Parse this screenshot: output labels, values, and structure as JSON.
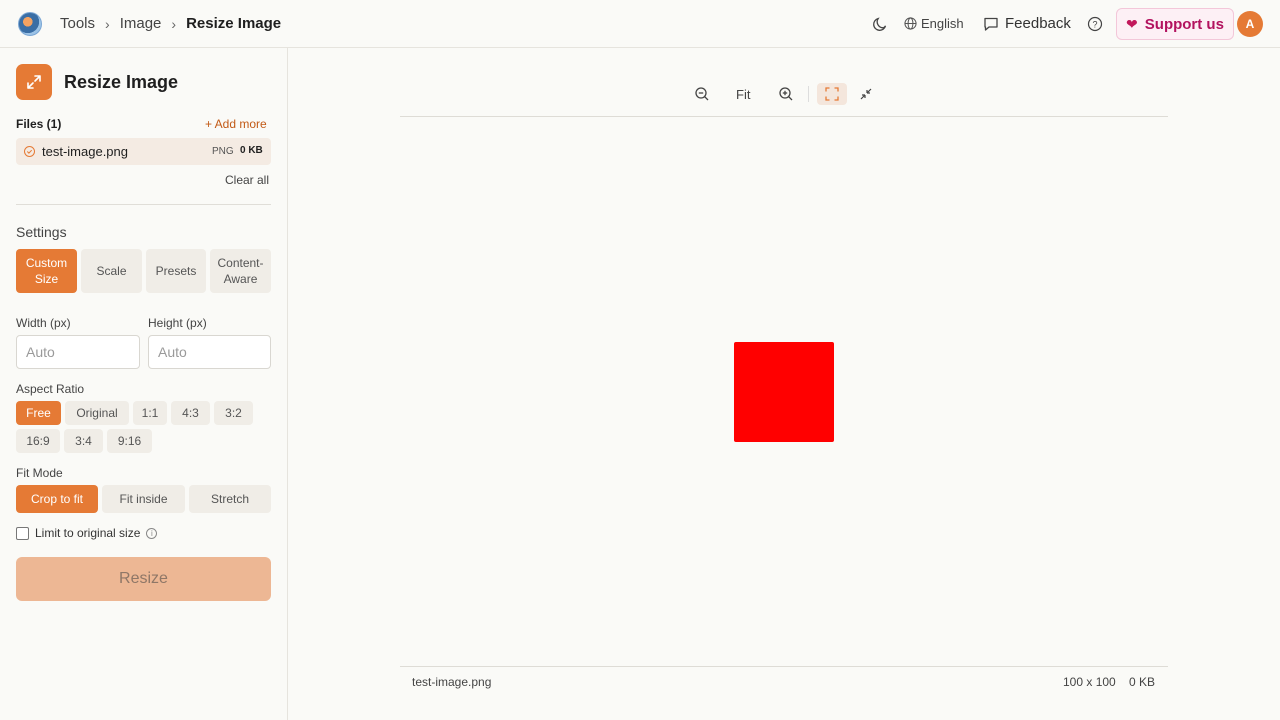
{
  "header": {
    "breadcrumbs": [
      "Tools",
      "Image",
      "Resize Image"
    ],
    "language": "English",
    "feedback": "Feedback",
    "support": "Support us",
    "avatar": "A"
  },
  "sidebar": {
    "title": "Resize Image",
    "files_label": "Files (1)",
    "add_more": "+ Add more",
    "file": {
      "name": "test-image.png",
      "type": "PNG",
      "size": "0 KB"
    },
    "clear_all": "Clear all",
    "settings_label": "Settings",
    "modes": [
      "Custom Size",
      "Scale",
      "Presets",
      "Content-Aware"
    ],
    "active_mode": "Custom Size",
    "width_label": "Width (px)",
    "height_label": "Height (px)",
    "width_placeholder": "Auto",
    "height_placeholder": "Auto",
    "aspect_label": "Aspect Ratio",
    "aspect_options": [
      "Free",
      "Original",
      "1:1",
      "4:3",
      "3:2",
      "16:9",
      "3:4",
      "9:16"
    ],
    "active_aspect": "Free",
    "fit_label": "Fit Mode",
    "fit_options": [
      "Crop to fit",
      "Fit inside",
      "Stretch"
    ],
    "active_fit": "Crop to fit",
    "limit_label": "Limit to original size",
    "resize_button": "Resize"
  },
  "preview": {
    "fit_label": "Fit",
    "status_name": "test-image.png",
    "status_dims": "100 x 100",
    "status_size": "0 KB"
  },
  "colors": {
    "accent": "#e57a35",
    "preview_fill": "#ff0000"
  }
}
